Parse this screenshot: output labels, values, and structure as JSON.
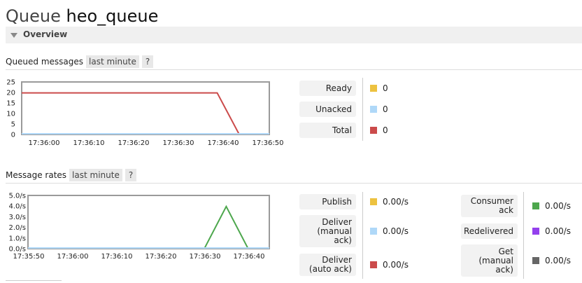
{
  "header": {
    "prefix": "Queue",
    "queue_name": "heo_queue"
  },
  "section": {
    "label": "Overview"
  },
  "queued": {
    "label": "Queued messages",
    "range_label": "last minute",
    "help": "?",
    "legend": [
      {
        "name": "Ready",
        "value": "0",
        "color": "#edc240"
      },
      {
        "name": "Unacked",
        "value": "0",
        "color": "#afd8f8"
      },
      {
        "name": "Total",
        "value": "0",
        "color": "#cb4b4b"
      }
    ]
  },
  "rates": {
    "label": "Message rates",
    "range_label": "last minute",
    "help": "?",
    "legend_left": [
      {
        "name": "Publish",
        "value": "0.00/s",
        "color": "#edc240"
      },
      {
        "name": "Deliver\n(manual\nack)",
        "value": "0.00/s",
        "color": "#afd8f8"
      },
      {
        "name": "Deliver\n(auto ack)",
        "value": "0.00/s",
        "color": "#cb4b4b"
      }
    ],
    "legend_right": [
      {
        "name": "Consumer\nack",
        "value": "0.00/s",
        "color": "#4da74d"
      },
      {
        "name": "Redelivered",
        "value": "0.00/s",
        "color": "#9440ed"
      },
      {
        "name": "Get\n(manual\nack)",
        "value": "0.00/s",
        "color": "#666666"
      }
    ]
  },
  "chart_data": [
    {
      "type": "line",
      "x_ticks": [
        "17:36:00",
        "17:36:10",
        "17:36:20",
        "17:36:30",
        "17:36:40",
        "17:36:50"
      ],
      "y_ticks": [
        "0",
        "5",
        "10",
        "15",
        "20",
        "25"
      ],
      "ylim": [
        0,
        25
      ],
      "xlim": [
        -7,
        50
      ],
      "series": [
        {
          "name": "Total",
          "color": "#cb4b4b",
          "x": [
            -7,
            38,
            43,
            50
          ],
          "y": [
            20,
            20,
            0,
            0
          ]
        },
        {
          "name": "Ready",
          "color": "#afd8f8",
          "x": [
            -7,
            50
          ],
          "y": [
            0,
            0
          ]
        }
      ]
    },
    {
      "type": "line",
      "x_ticks": [
        "17:35:50",
        "17:36:00",
        "17:36:10",
        "17:36:20",
        "17:36:30",
        "17:36:40"
      ],
      "y_ticks": [
        "0.0/s",
        "1.0/s",
        "2.0/s",
        "3.0/s",
        "4.0/s",
        "5.0/s"
      ],
      "ylim": [
        0,
        5
      ],
      "xlim": [
        -1,
        55
      ],
      "series": [
        {
          "name": "Consumer ack",
          "color": "#4da74d",
          "x": [
            -1,
            40,
            45,
            50,
            55
          ],
          "y": [
            0,
            0,
            4,
            0,
            0
          ]
        },
        {
          "name": "Deliver (manual ack)",
          "color": "#afd8f8",
          "x": [
            -1,
            55
          ],
          "y": [
            0,
            0
          ]
        }
      ]
    }
  ]
}
